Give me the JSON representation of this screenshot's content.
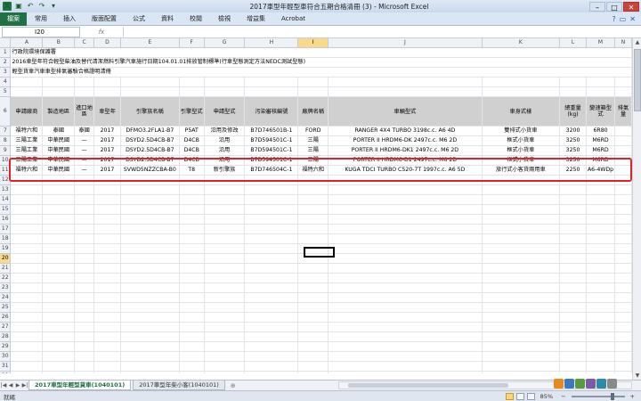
{
  "window": {
    "title": "2017車型年輕型車符合五期合格清冊 (3) - Microsoft Excel",
    "buttons": {
      "minimize": "–",
      "maximize": "□",
      "close": "✕"
    }
  },
  "ribbon": {
    "file": "檔案",
    "tabs": [
      "常用",
      "插入",
      "版面配置",
      "公式",
      "資料",
      "校閱",
      "檢視",
      "增益集",
      "Acrobat"
    ]
  },
  "formula_bar": {
    "name_box": "I20",
    "fx": "fx",
    "value": ""
  },
  "columns": [
    "A",
    "B",
    "C",
    "D",
    "E",
    "F",
    "G",
    "H",
    "I",
    "J",
    "K",
    "L",
    "M",
    "N"
  ],
  "selected_column": "I",
  "selected_row": "20",
  "rows": [
    {
      "num": "1",
      "cells": [
        "行政院環境保護署"
      ]
    },
    {
      "num": "2",
      "cells": [
        "2016車型年符合輕型柴油及替代清潔燃料引擎汽車施行日期104.01.01排放管制標準(行車型態測定方法NEDC測試型態)"
      ]
    },
    {
      "num": "3",
      "cells": [
        "輕型貨車汽車車型排氣審驗合格證明清冊"
      ]
    },
    {
      "num": "4",
      "cells": []
    },
    {
      "num": "5",
      "cells": []
    }
  ],
  "header_row": {
    "num": "6",
    "cells": [
      "申請廠商",
      "製造地區",
      "進口地區",
      "車型年",
      "引擎族名稱",
      "引擎型式",
      "申請型式",
      "污染審核編號",
      "廠牌名稱",
      "車輛型式",
      "車身式樣",
      "總重量(kg)",
      "變速箱型式",
      "排氣量"
    ]
  },
  "data_rows": [
    {
      "num": "7",
      "cells": [
        "福特六和",
        "泰國",
        "泰國",
        "2017",
        "DFMO3.2FLA1-B7",
        "P5AT",
        "沿用及修改",
        "B7D746501B-1",
        "FORD",
        "RANGER 4X4 TURBO 3198c.c. A6 4D",
        "雙排式小貨車",
        "3200",
        "6R80",
        ""
      ]
    },
    {
      "num": "8",
      "cells": [
        "三陽工業",
        "中華民國",
        "—",
        "2017",
        "DSYD2.5D4CB-B7",
        "D4CB",
        "沿用",
        "B7D594501C-1",
        "三陽",
        "PORTER II HRDM6-DK 2497c.c. M6 2D",
        "框式小貨車",
        "3250",
        "M6RD",
        ""
      ]
    },
    {
      "num": "9",
      "cells": [
        "三陽工業",
        "中華民國",
        "—",
        "2017",
        "DSYD2.5D4CB-B7",
        "D4CB",
        "沿用",
        "B7D594501C-1",
        "三陽",
        "PORTER II HRDM6-DK1 2497c.c. M6 2D",
        "框式小貨車",
        "3250",
        "M6RD",
        ""
      ]
    },
    {
      "num": "10",
      "cells": [
        "三陽工業",
        "中華民國",
        "—",
        "2017",
        "DSYD2.5D4CB-B7",
        "D4CB",
        "沿用",
        "B7D594501C-1",
        "三陽",
        "PORTER II HRDM6-D1 2497c.c. M6 2D",
        "框式小貨車",
        "3250",
        "M6RD",
        ""
      ]
    },
    {
      "num": "11",
      "cells": [
        "福特六和",
        "中華民國",
        "—",
        "2017",
        "SVWD5NZZCBA-B0",
        "T8",
        "新引擎族",
        "B7D746504C-1",
        "福特六和",
        "KUGA TDCI TURBO C520-7T 1997c.c. A6 5D",
        "旅行式小客貨兩用車",
        "2250",
        "A6-4WDp",
        ""
      ]
    }
  ],
  "empty_rows": [
    "12",
    "13",
    "14",
    "15",
    "16",
    "17",
    "18",
    "19",
    "20",
    "21",
    "22",
    "23",
    "24",
    "25",
    "26",
    "27",
    "28",
    "29",
    "30",
    "31",
    "32",
    "33"
  ],
  "sheet_tabs": [
    "2017車型年輕型貨車(1040101)",
    "2017車型年柴小客(1040101)"
  ],
  "active_sheet": 0,
  "status": {
    "ready": "就緒",
    "zoom": "85%"
  }
}
